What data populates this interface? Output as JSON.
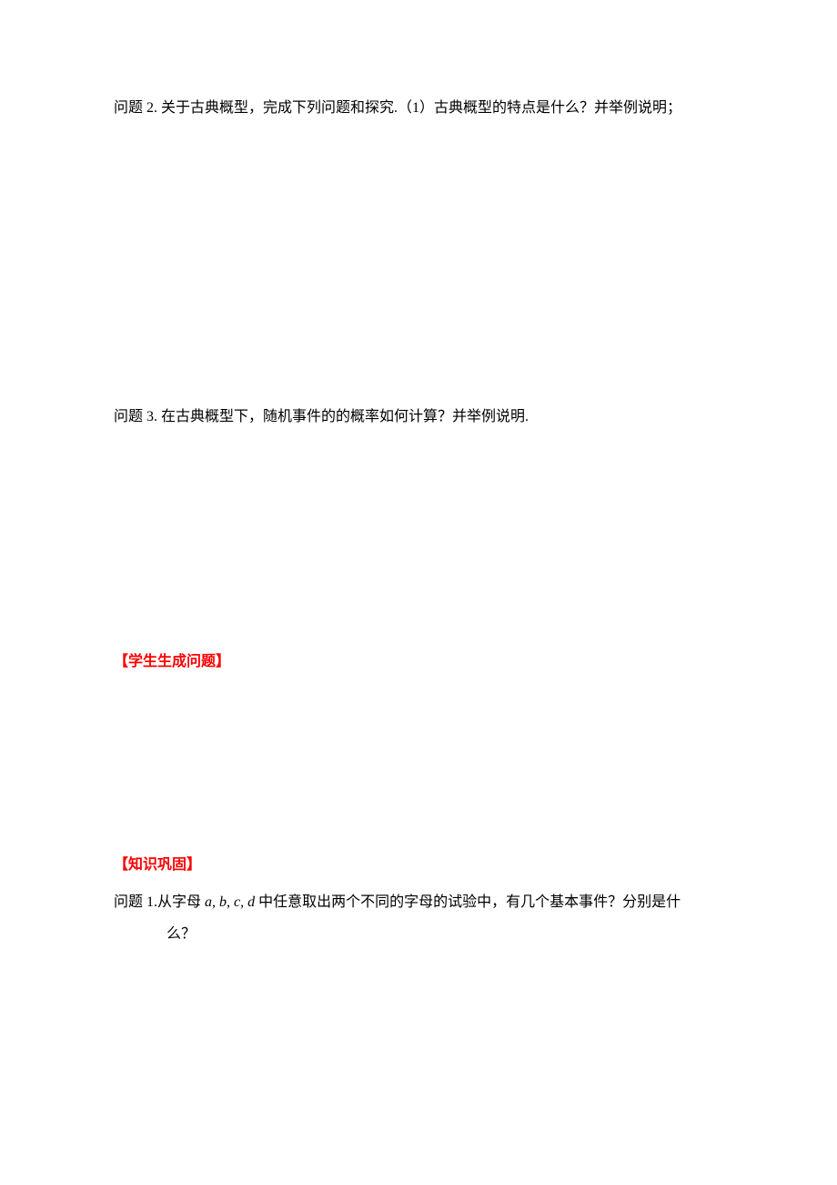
{
  "questions": {
    "q2": "问题 2. 关于古典概型，完成下列问题和探究.（1）古典概型的特点是什么？并举例说明；",
    "q3": "问题 3. 在古典概型下，随机事件的的概率如何计算？并举例说明."
  },
  "sections": {
    "student_generated": "【学生生成问题】",
    "knowledge_consolidation": "【知识巩固】"
  },
  "consolidation": {
    "q1_prefix": "问题 1.",
    "q1_text1": "从字母 ",
    "q1_vars": "a, b, c, d ",
    "q1_text2": "中任意取出两个不同的字母的试验中，有几个基本事件？分别是什",
    "q1_line2": "么？"
  }
}
